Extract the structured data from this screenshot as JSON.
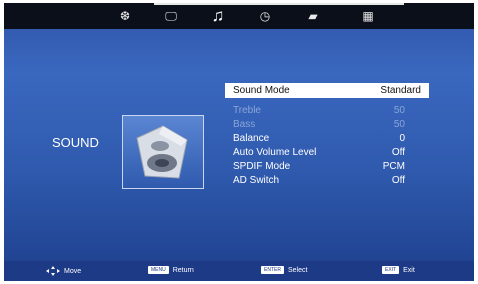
{
  "top_tabs": [
    {
      "icon": "picture-icon",
      "glyph": "❆"
    },
    {
      "icon": "monitor-icon",
      "glyph": "🖵"
    },
    {
      "icon": "music-note-icon",
      "glyph": "♫"
    },
    {
      "icon": "clock-icon",
      "glyph": "◷"
    },
    {
      "icon": "lock-icon",
      "glyph": "▰"
    },
    {
      "icon": "grid-icon",
      "glyph": "▦"
    }
  ],
  "section_title": "SOUND",
  "menu": [
    {
      "label": "Sound Mode",
      "value": "Standard"
    },
    {
      "label": "Treble",
      "value": "50"
    },
    {
      "label": "Bass",
      "value": "50"
    },
    {
      "label": "Balance",
      "value": "0"
    },
    {
      "label": "Auto Volume Level",
      "value": "Off"
    },
    {
      "label": "SPDIF Mode",
      "value": "PCM"
    },
    {
      "label": "AD Switch",
      "value": "Off"
    }
  ],
  "hints": {
    "move": "Move",
    "menu_key": "MENU",
    "return": "Return",
    "enter_key": "ENTER",
    "select": "Select",
    "exit_key": "EXIT",
    "exit": "Exit"
  }
}
